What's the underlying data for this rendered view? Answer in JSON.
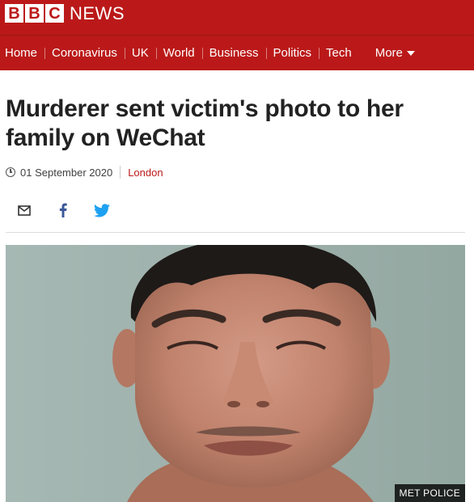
{
  "brand": {
    "letters": [
      "B",
      "B",
      "C"
    ],
    "suffix": "NEWS",
    "color": "#bb1919"
  },
  "nav": {
    "items": [
      "Home",
      "Coronavirus",
      "UK",
      "World",
      "Business",
      "Politics",
      "Tech"
    ],
    "more_label": "More",
    "more_icon": "chevron-down-icon"
  },
  "article": {
    "headline": "Murderer sent victim's photo to her family on WeChat",
    "date": "01 September 2020",
    "location": "London",
    "location_color": "#bb1919"
  },
  "share": {
    "buttons": [
      {
        "icon": "email-icon"
      },
      {
        "icon": "facebook-icon",
        "color": "#3b5998"
      },
      {
        "icon": "twitter-icon",
        "color": "#1da1f2"
      }
    ]
  },
  "image": {
    "caption": "MET POLICE",
    "subject": "custody photograph of a man"
  }
}
